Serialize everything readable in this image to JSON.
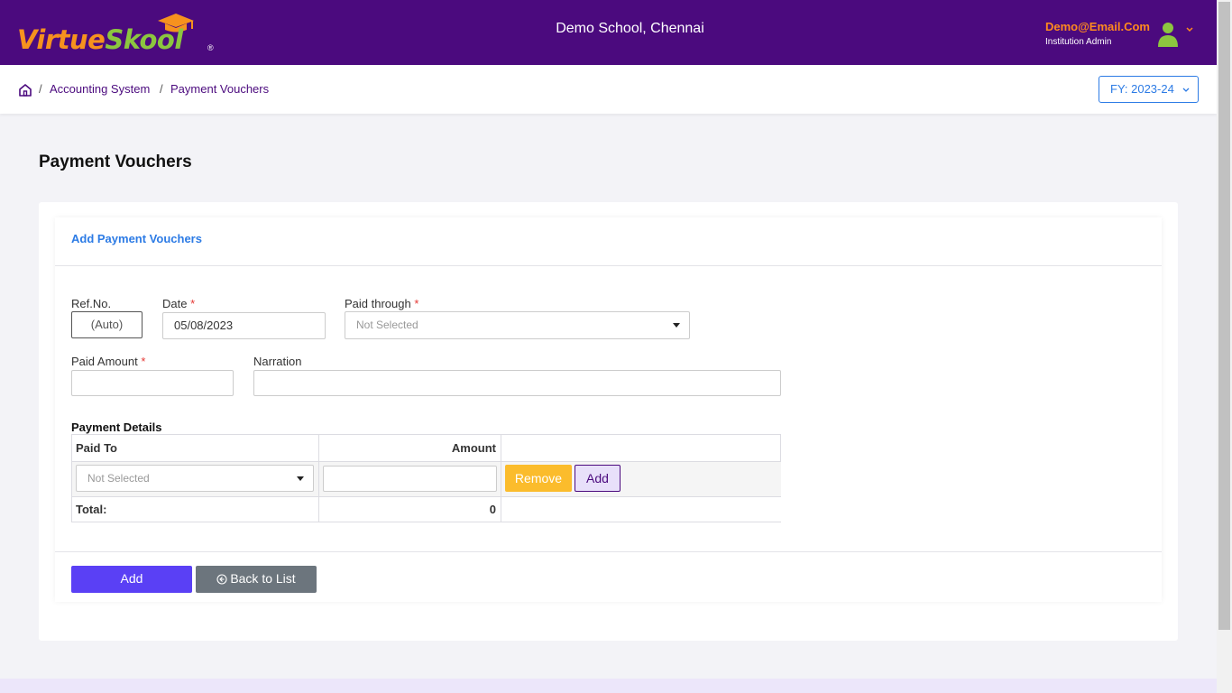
{
  "header": {
    "logo_text_left": "Virtue",
    "logo_text_right": "Skool",
    "logo_reg": "®",
    "school_name": "Demo School, Chennai",
    "user_email": "Demo@Email.Com",
    "user_role": "Institution Admin",
    "colors": {
      "topbar": "#4b0a7e",
      "email": "#ff8a1e",
      "logo_orange": "#f6921e",
      "logo_green": "#8cc63f"
    }
  },
  "breadcrumb": {
    "home_icon": "home-icon",
    "separator": "/",
    "items": [
      "Accounting System",
      "Payment Vouchers"
    ]
  },
  "fy_selector": {
    "label": "FY: 2023-24"
  },
  "page": {
    "title": "Payment Vouchers",
    "card_title": "Add Payment Vouchers"
  },
  "form": {
    "ref_no": {
      "label": "Ref.No.",
      "value": "(Auto)"
    },
    "date": {
      "label": "Date",
      "required_mark": "*",
      "value": "05/08/2023"
    },
    "paid_through": {
      "label": "Paid through",
      "required_mark": "*",
      "value": "Not Selected"
    },
    "paid_amount": {
      "label": "Paid Amount",
      "required_mark": "*",
      "value": ""
    },
    "narration": {
      "label": "Narration",
      "value": ""
    }
  },
  "payment_details": {
    "title": "Payment Details",
    "columns": [
      "Paid To",
      "Amount"
    ],
    "row": {
      "paid_to": "Not Selected",
      "amount": ""
    },
    "remove_label": "Remove",
    "add_label": "Add",
    "total_label": "Total:",
    "total_value": "0"
  },
  "actions": {
    "add_label": "Add",
    "back_label": "Back to List"
  }
}
